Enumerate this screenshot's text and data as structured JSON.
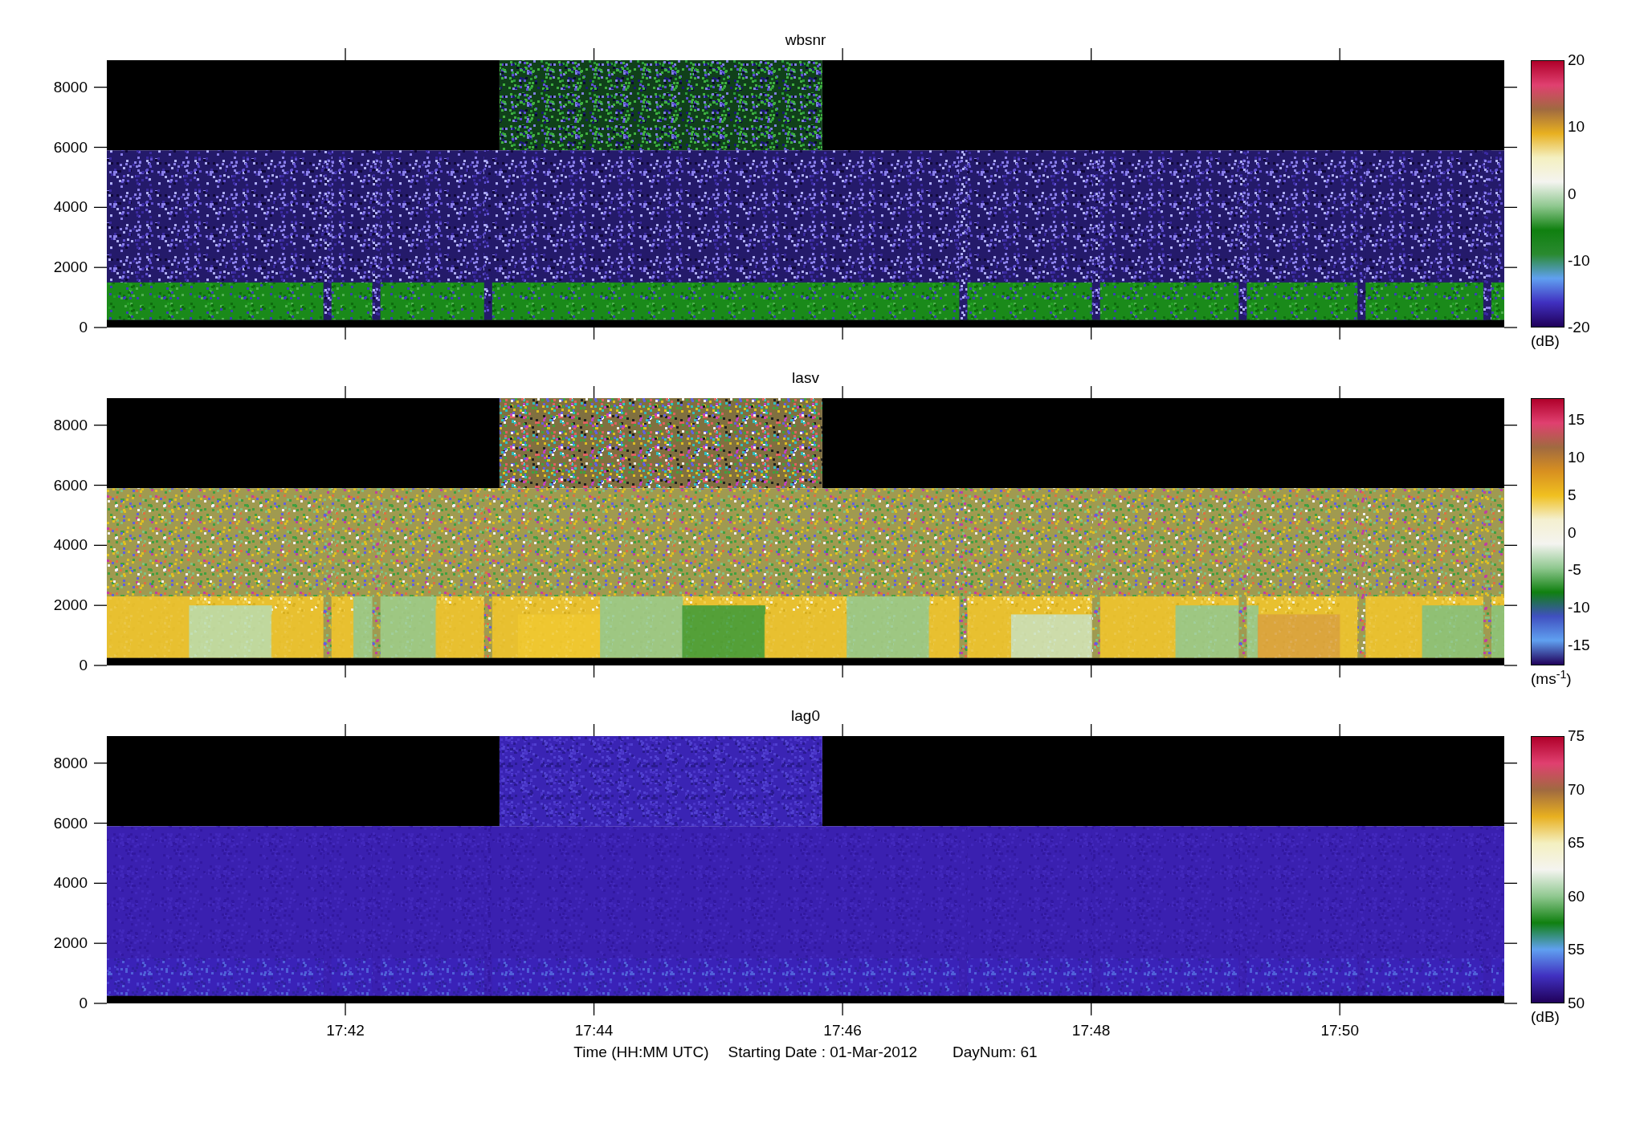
{
  "panels": [
    {
      "title": "wbsnr",
      "kind": "snr",
      "yticks": [
        "8000",
        "6000",
        "4000",
        "2000",
        "0"
      ],
      "colorbar": {
        "ticks": [
          "20",
          "10",
          "0",
          "-10",
          "-20"
        ],
        "unit": "(dB)"
      }
    },
    {
      "title": "lasv",
      "kind": "vel",
      "yticks": [
        "8000",
        "6000",
        "4000",
        "2000",
        "0"
      ],
      "colorbar": {
        "ticks": [
          "15",
          "10",
          "5",
          "0",
          "-5",
          "-10",
          "-15"
        ],
        "unit": "(ms$^{-1}$)"
      }
    },
    {
      "title": "lag0",
      "kind": "pow",
      "yticks": [
        "8000",
        "6000",
        "4000",
        "2000",
        "0"
      ],
      "colorbar": {
        "ticks": [
          "75",
          "70",
          "65",
          "60",
          "55",
          "50"
        ],
        "unit": "(dB)"
      }
    }
  ],
  "xticks": [
    "17:42",
    "17:44",
    "17:46",
    "17:48",
    "17:50"
  ],
  "footer": [
    "Time (HH:MM UTC)",
    "Starting Date : 01-Mar-2012",
    "DayNum: 61"
  ]
}
